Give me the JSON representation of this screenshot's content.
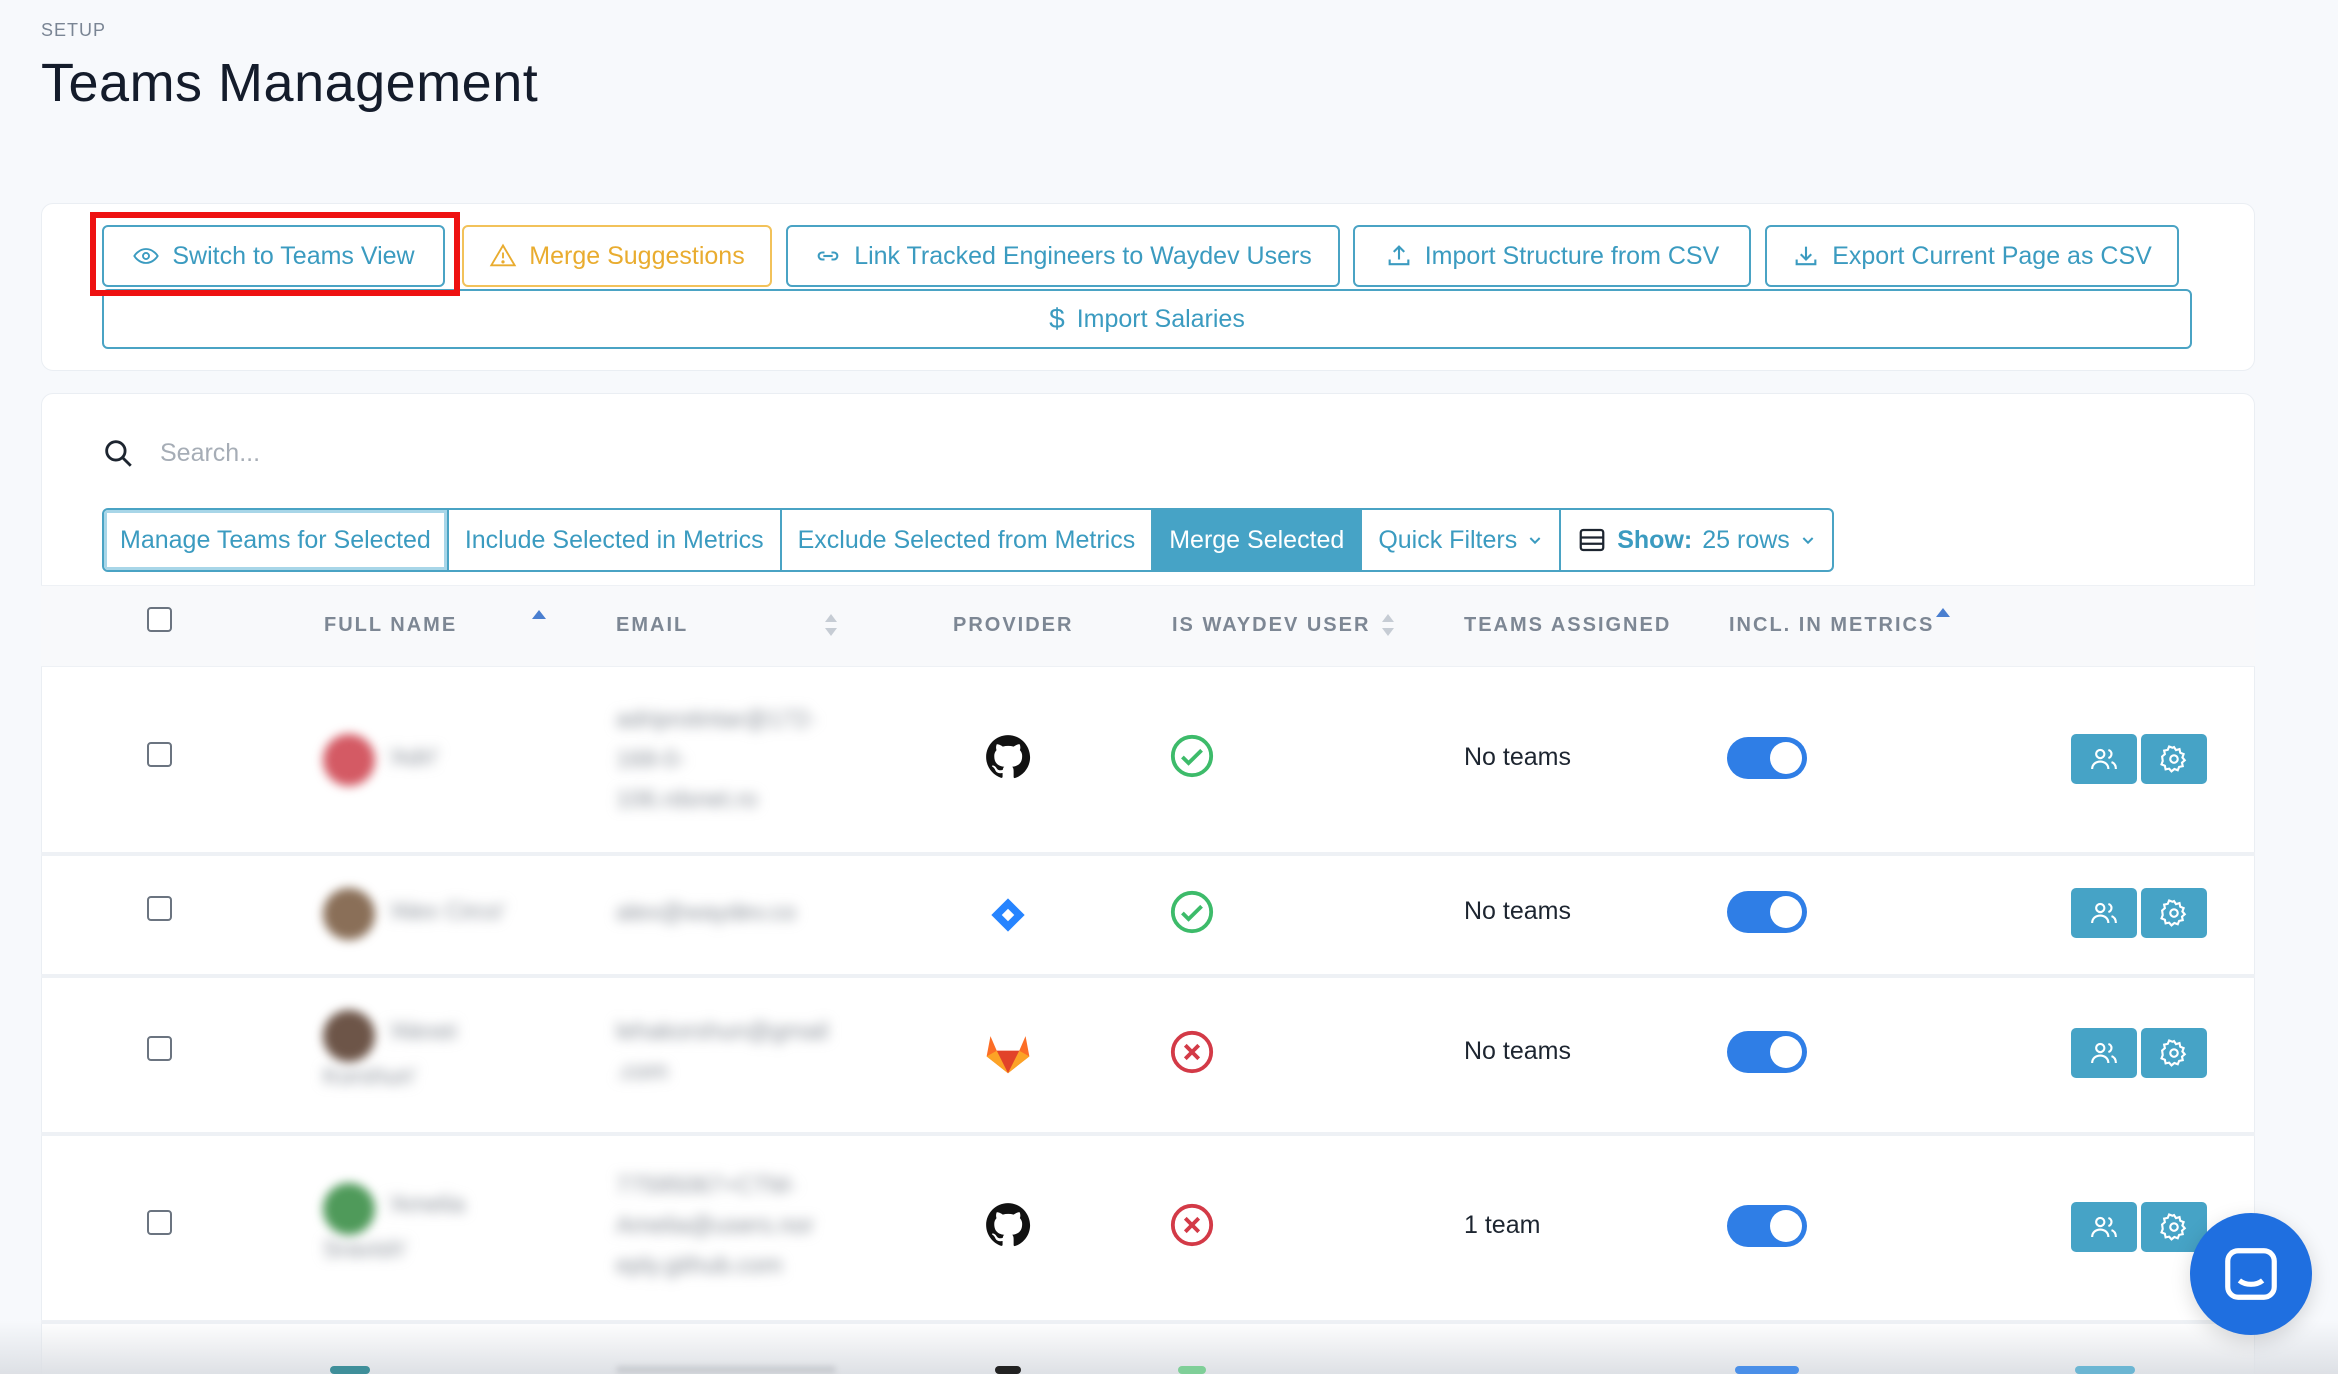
{
  "header": {
    "eyebrow": "SETUP",
    "title": "Teams Management"
  },
  "toolbar": {
    "switch_view": "Switch to Teams View",
    "merge_suggestions": "Merge Suggestions",
    "link_engineers": "Link Tracked Engineers to Waydev Users",
    "import_structure": "Import Structure from CSV",
    "export_page": "Export Current Page as CSV",
    "import_salaries": "Import Salaries"
  },
  "search": {
    "placeholder": "Search..."
  },
  "actions": {
    "manage_teams": "Manage Teams for Selected",
    "include_metrics": "Include Selected in Metrics",
    "exclude_metrics": "Exclude Selected from Metrics",
    "merge_selected": "Merge Selected",
    "quick_filters": "Quick Filters",
    "show_label": "Show:",
    "show_value": "25 rows"
  },
  "table": {
    "columns": {
      "full_name": "FULL NAME",
      "email": "EMAIL",
      "provider": "PROVIDER",
      "is_waydev_user": "IS WAYDEV USER",
      "teams_assigned": "TEAMS ASSIGNED",
      "incl_in_metrics": "INCL. IN METRICS"
    },
    "rows": [
      {
        "name_l1": "'Adri'",
        "name_l2": "",
        "email_l1": "adriprotintar@172-",
        "email_l2": "168-0-",
        "email_l3": "106.rdsnet.ro",
        "provider": "github",
        "is_waydev_user": true,
        "teams": "No teams",
        "included": true
      },
      {
        "name_l1": "'Alex Circo'",
        "name_l2": "",
        "email_l1": "alex@waydev.co",
        "email_l2": "",
        "email_l3": "",
        "provider": "jira",
        "is_waydev_user": true,
        "teams": "No teams",
        "included": true
      },
      {
        "name_l1": "'Alexei",
        "name_l2": "Korshun'",
        "email_l1": "lehakorshun@gmail",
        "email_l2": ".com",
        "email_l3": "",
        "provider": "gitlab",
        "is_waydev_user": false,
        "teams": "No teams",
        "included": true
      },
      {
        "name_l1": "'Amelia",
        "name_l2": "Sravish'",
        "email_l1": "77595067+CTM-",
        "email_l2": "Amelia@users.nor",
        "email_l3": "eply.github.com",
        "provider": "github",
        "is_waydev_user": false,
        "teams": "1 team",
        "included": true
      }
    ]
  },
  "colors": {
    "accent": "#46a3c6",
    "warning": "#e9ac2f",
    "toggle_on": "#2f7ee6",
    "success": "#3dbb6a",
    "danger": "#d33a47",
    "chat": "#1f6fe0"
  }
}
